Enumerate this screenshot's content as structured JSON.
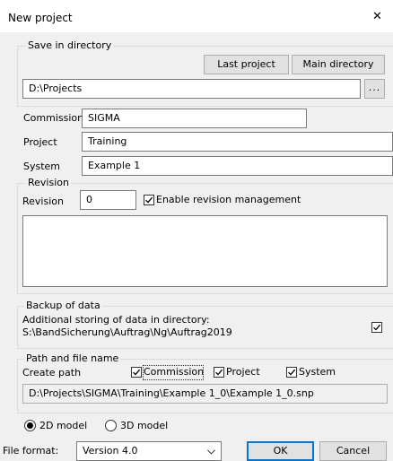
{
  "window": {
    "title": "New project",
    "close_glyph": "✕"
  },
  "save_dir": {
    "legend": "Save in directory",
    "last_project_label": "Last project",
    "main_directory_label": "Main directory",
    "path_value": "D:\\Projects",
    "browse_label": "..."
  },
  "fields": {
    "commission_label": "Commission",
    "commission_value": "SIGMA",
    "project_label": "Project",
    "project_value": "Training",
    "system_label": "System",
    "system_value": "Example 1"
  },
  "revision": {
    "legend": "Revision",
    "label": "Revision",
    "value": "0",
    "enable_label": "Enable revision management",
    "enable_checked": true,
    "notes_value": ""
  },
  "backup": {
    "legend": "Backup of data",
    "line1": "Additional storing of data in directory:",
    "line2": "S:\\BandSicherung\\Auftrag\\Ng\\Auftrag2019",
    "checked": true
  },
  "path": {
    "legend": "Path and file name",
    "create_label": "Create path",
    "commission_label": "Commission",
    "commission_checked": true,
    "project_label": "Project",
    "project_checked": true,
    "system_label": "System",
    "system_checked": true,
    "full_path": "D:\\Projects\\SIGMA\\Training\\Example 1_0\\Example 1_0.snp"
  },
  "model": {
    "option_2d": "2D model",
    "option_3d": "3D model",
    "selected": "2D model"
  },
  "file_format": {
    "label": "File format:",
    "value": "Version 4.0"
  },
  "buttons": {
    "ok": "OK",
    "cancel": "Cancel"
  }
}
